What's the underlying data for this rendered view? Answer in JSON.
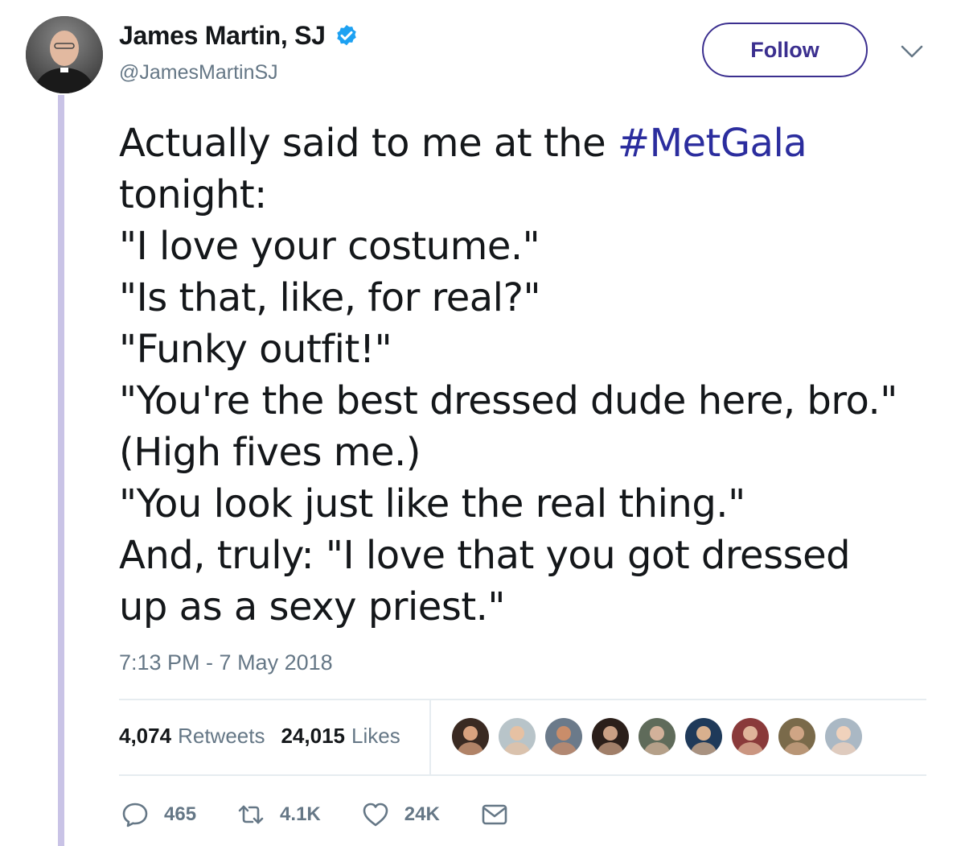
{
  "author": {
    "display_name": "James Martin, SJ",
    "handle": "@JamesMartinSJ",
    "verified": true
  },
  "follow_button": {
    "label": "Follow"
  },
  "tweet": {
    "lines": [
      {
        "prefix": "Actually said to me at the ",
        "hashtag": "#MetGala"
      },
      {
        "text": "tonight:"
      },
      {
        "text": "\"I love your costume.\""
      },
      {
        "text": "\"Is that, like, for real?\""
      },
      {
        "text": "\"Funky outfit!\""
      },
      {
        "text": "\"You're the best dressed dude here, bro.\""
      },
      {
        "text": "(High fives me.)"
      },
      {
        "text": "\"You look just like the real thing.\""
      },
      {
        "text": "And, truly: \"I love that you got dressed"
      },
      {
        "text": "up as a sexy priest.\""
      }
    ],
    "timestamp": "7:13 PM - 7 May 2018"
  },
  "stats": {
    "retweets": {
      "count": "4,074",
      "label": "Retweets"
    },
    "likes": {
      "count": "24,015",
      "label": "Likes"
    }
  },
  "likers_count": 9,
  "actions": {
    "reply": {
      "icon": "reply-icon",
      "count": "465"
    },
    "retweet": {
      "icon": "retweet-icon",
      "count": "4.1K"
    },
    "like": {
      "icon": "heart-icon",
      "count": "24K"
    },
    "message": {
      "icon": "envelope-icon"
    }
  },
  "colors": {
    "hashtag": "#2b2d9e",
    "follow": "#3b2f8f",
    "secondary_text": "#657786",
    "thread_line": "#c9c3e6",
    "verified": "#1da1f2"
  }
}
